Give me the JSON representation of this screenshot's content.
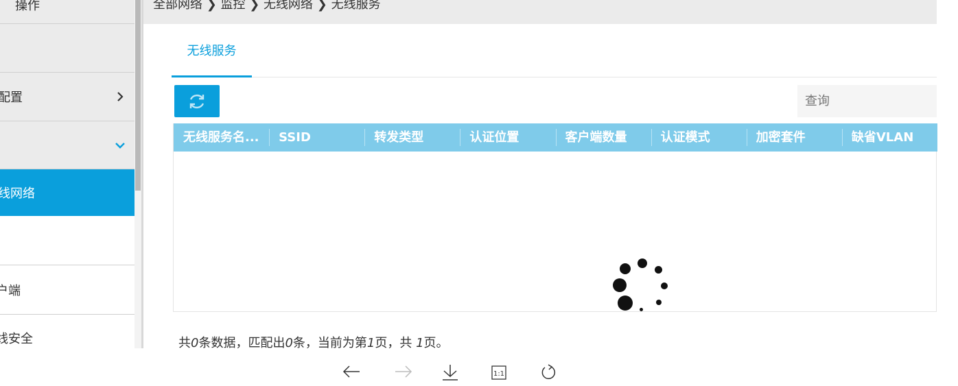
{
  "breadcrumb": "全部网络 ❯ 监控 ❯ 无线网络 ❯ 无线服务",
  "sidebar": {
    "items": [
      {
        "label": "操作"
      },
      {
        "label": ""
      },
      {
        "label": "配置"
      },
      {
        "label": ""
      },
      {
        "label": "线网络"
      },
      {
        "label": ""
      },
      {
        "label": "户端"
      },
      {
        "label": "线安全"
      }
    ]
  },
  "tabs": [
    {
      "label": "无线服务"
    }
  ],
  "toolbar": {
    "search_placeholder": "查询"
  },
  "table": {
    "columns": [
      "无线服务名...",
      "SSID",
      "转发类型",
      "认证位置",
      "客户端数量",
      "认证模式",
      "加密套件",
      "缺省VLAN"
    ]
  },
  "summary": {
    "prefix": "共",
    "total": "0",
    "mid1": "条数据，匹配出",
    "matched": "0",
    "mid2": "条，当前为第",
    "page": "1",
    "mid3": "页，共 ",
    "pages": "1",
    "suffix": "页。"
  },
  "viewer": {
    "zoom_label": "1:1"
  },
  "colors": {
    "accent": "#0a9fdc",
    "header": "#7fcbea",
    "sidebar": "#ebebeb"
  }
}
